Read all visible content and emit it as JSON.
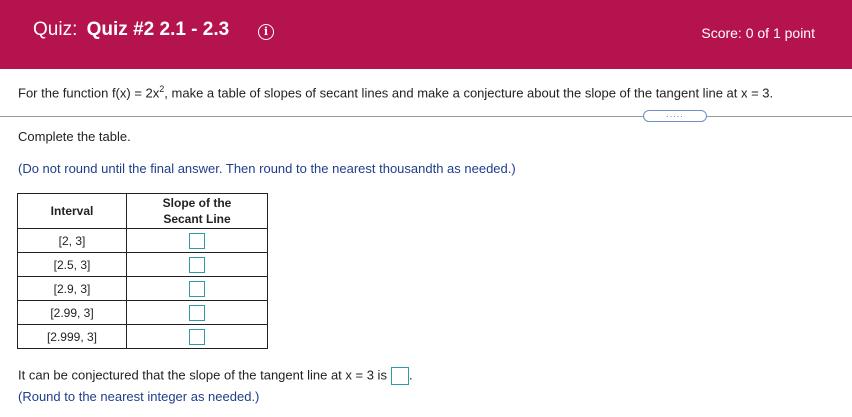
{
  "header": {
    "prefix": "Quiz:",
    "quiz_name": "Quiz #2 2.1 - 2.3",
    "info_icon": "info-icon",
    "score": "Score: 0 of 1 point",
    "background_color": "#b5134d"
  },
  "question": {
    "text_before": "For the function f(x) = 2x",
    "exponent": "2",
    "text_after": ", make a table of slopes of secant lines and make a conjecture about the slope of the tangent line at x = 3."
  },
  "more_button": {
    "label": "....."
  },
  "body": {
    "complete_text": "Complete the table.",
    "instruction": "(Do not round until the final answer. Then round to the nearest thousandth as needed.)"
  },
  "table": {
    "headers": {
      "interval": "Interval",
      "slope_line1": "Slope of the",
      "slope_line2": "Secant Line"
    },
    "rows": [
      {
        "interval": "[2, 3]",
        "slope": ""
      },
      {
        "interval": "[2.5, 3]",
        "slope": ""
      },
      {
        "interval": "[2.9, 3]",
        "slope": ""
      },
      {
        "interval": "[2.99, 3]",
        "slope": ""
      },
      {
        "interval": "[2.999, 3]",
        "slope": ""
      }
    ]
  },
  "conclusion": {
    "text": "It can be conjectured that the slope of the tangent line at x = 3 is",
    "period": ".",
    "round_note": "(Round to the nearest integer as needed.)"
  }
}
